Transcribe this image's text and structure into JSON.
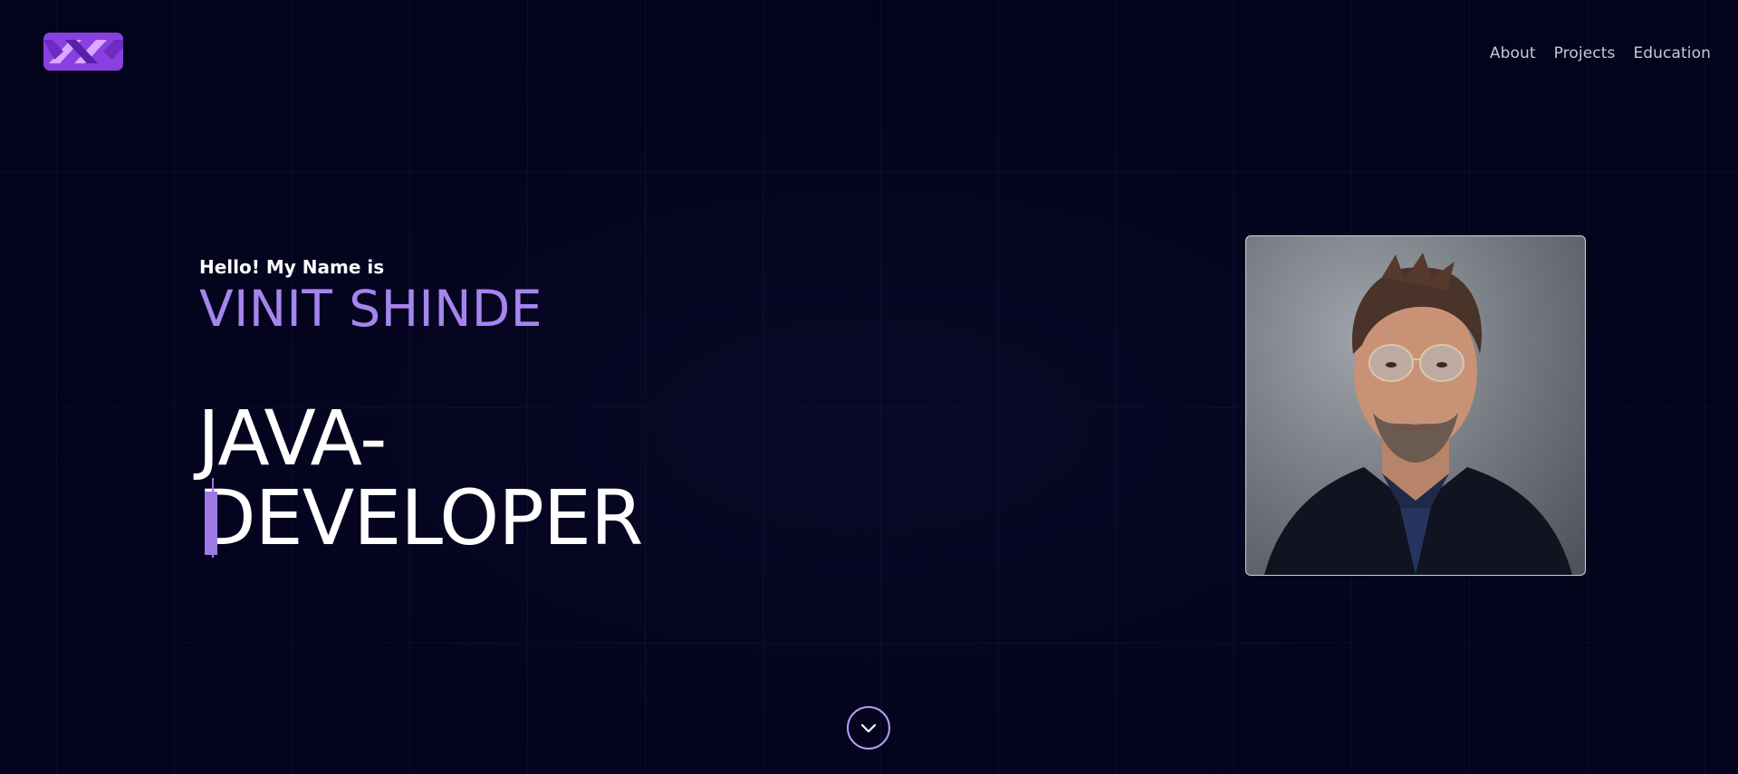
{
  "nav": {
    "items": [
      {
        "label": "About"
      },
      {
        "label": "Projects"
      },
      {
        "label": "Education"
      }
    ]
  },
  "hero": {
    "greeting": "Hello! My Name is",
    "name": "VINIT SHINDE",
    "role_line1": "JAVA-",
    "role_line2": "DEVELOPER"
  },
  "colors": {
    "background": "#03031c",
    "accent": "#a685ee",
    "text": "#ffffff",
    "nav_text": "#c9c9d6"
  },
  "icons": {
    "logo": "logo-icon",
    "scroll": "chevron-down-icon"
  }
}
